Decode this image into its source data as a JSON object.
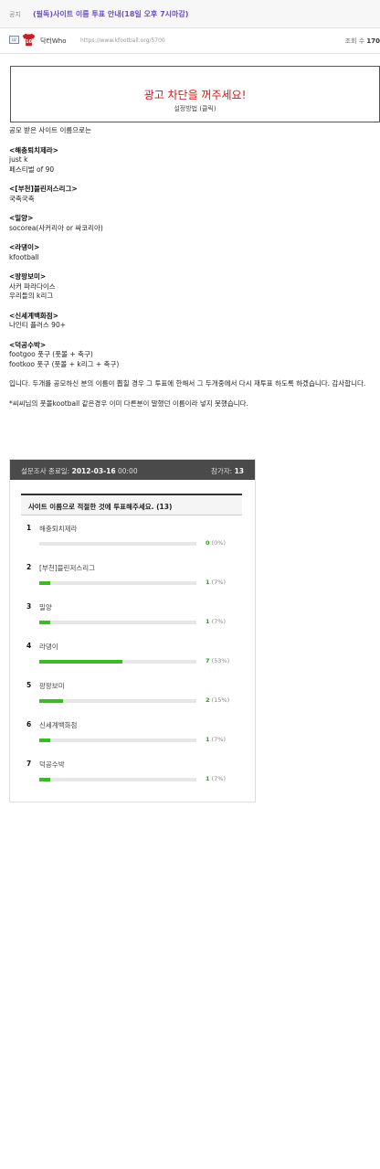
{
  "header": {
    "notice_tag": "공지",
    "title": "(필독)사이트 이름 투표 안내(18일 오후 7시마감)"
  },
  "author": {
    "name": "닥터Who",
    "jersey_number": "10",
    "url": "https://www.kfootball.org/5700",
    "views_label": "조회 수",
    "views_value": "170"
  },
  "ad": {
    "title": "광고 차단을 꺼주세요!",
    "subtitle": "설정방법 (클릭)"
  },
  "content": {
    "intro": "공모 받은 사이트 이름으로는",
    "candidates": [
      {
        "title": "<해충퇴치제라>",
        "lines": [
          "just k",
          "페스티벌 of 90"
        ]
      },
      {
        "title": "<[부천]블린저스리그>",
        "lines": [
          "국축국축"
        ]
      },
      {
        "title": "<밀양>",
        "lines": [
          "socorea(사커리아 or 싸코리아)"
        ]
      },
      {
        "title": "<라댕이>",
        "lines": [
          "kfootball"
        ]
      },
      {
        "title": "<팡팡보미>",
        "lines": [
          "사커 파라다이스",
          "우리들의 k리그"
        ]
      },
      {
        "title": "<신세계백화점>",
        "lines": [
          "나인티 플러스 90+"
        ]
      },
      {
        "title": "<덕공수박>",
        "lines": [
          "footgoo 풋구 (풋볼 + 축구)",
          "footkoo 풋구 (풋볼 + k리그 + 축구)"
        ]
      }
    ],
    "closing": "입니다. 두개를 공모하신 분의 이름이 뽑힐 경우 그 투표에 한해서 그 두개중에서 다시 재투표 하도록 하겠습니다. 감사합니다.",
    "footnote": "*씨씨님의 풋볼kootball 같은경우 이미 다른분이 말했던 이름이라 넣지 못했습니다."
  },
  "poll": {
    "end_label": "설문조사 종료일:",
    "end_date": "2012-03-16",
    "end_time": "00:00",
    "participants_label": "참가자:",
    "participants": "13",
    "question": "사이트 이름으로 적절한 것에 투표해주세요. (13)",
    "options": [
      {
        "num": "1",
        "label": "해충퇴치제라",
        "votes": "0",
        "percent": "(0%)",
        "fraction": 0.0
      },
      {
        "num": "2",
        "label": "[부천]블린저스리그",
        "votes": "1",
        "percent": "(7%)",
        "fraction": 0.07
      },
      {
        "num": "3",
        "label": "밀양",
        "votes": "1",
        "percent": "(7%)",
        "fraction": 0.07
      },
      {
        "num": "4",
        "label": "라댕이",
        "votes": "7",
        "percent": "(53%)",
        "fraction": 0.53
      },
      {
        "num": "5",
        "label": "팡팡보미",
        "votes": "2",
        "percent": "(15%)",
        "fraction": 0.15
      },
      {
        "num": "6",
        "label": "신세계백화점",
        "votes": "1",
        "percent": "(7%)",
        "fraction": 0.07
      },
      {
        "num": "7",
        "label": "덕공수박",
        "votes": "1",
        "percent": "(7%)",
        "fraction": 0.07
      }
    ]
  },
  "colors": {
    "title": "#6a4ec9",
    "ad_title": "#e01010",
    "bar": "#3cba25"
  }
}
